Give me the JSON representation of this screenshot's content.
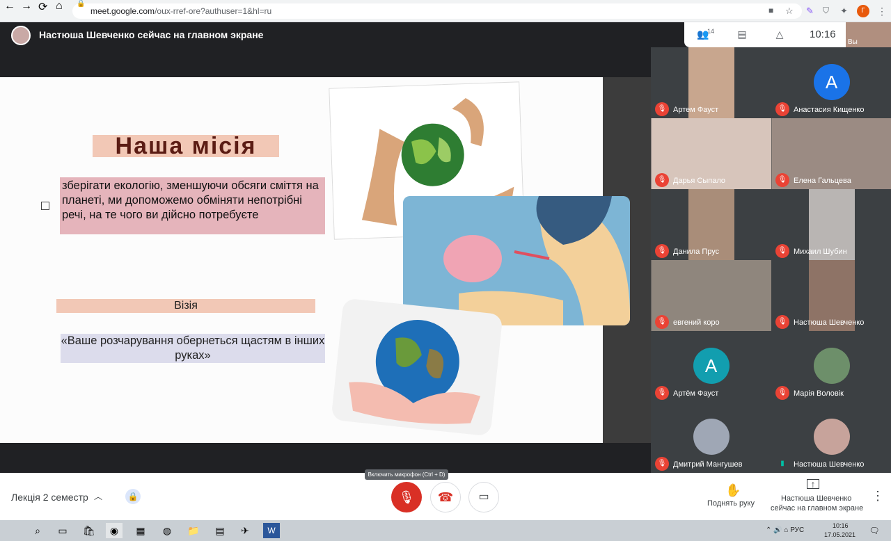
{
  "browser": {
    "url_host": "meet.google.com",
    "url_path": "/oux-rref-ore?authuser=1&hl=ru",
    "profile_letter": "Г"
  },
  "header": {
    "presenting_title": "Настюша Шевченко сейчас на главном экране",
    "participants_count": "14",
    "clock": "10:16",
    "self_label": "Вы"
  },
  "slide": {
    "mission_title": "Наша місія",
    "mission_text": "зберігати екологію, зменшуючи обсяги сміття на планеті, ми допоможемо обміняти непотрібні речі, на те чого ви дійсно потребуєте",
    "vision_title": "Візія",
    "vision_text": "«Ваше розчарування обернеться щастям в інших руках»"
  },
  "tiles": [
    {
      "name": "Артем Фауст",
      "kind": "photo",
      "color": "#c8a68e"
    },
    {
      "name": "Анастасия Кищенко",
      "kind": "avatar",
      "letter": "А",
      "color": "#1a73e8"
    },
    {
      "name": "Дарья Сыпало",
      "kind": "photo",
      "color": "#d7c5bb"
    },
    {
      "name": "Елена Гальцева",
      "kind": "photo",
      "color": "#9b8b83"
    },
    {
      "name": "Данила Прус",
      "kind": "photo",
      "color": "#a98d79"
    },
    {
      "name": "Михаил Шубин",
      "kind": "photo",
      "color": "#b9b5b3"
    },
    {
      "name": "евгений коро",
      "kind": "photo",
      "color": "#8f867d"
    },
    {
      "name": "Настюша Шевченко",
      "kind": "photo",
      "color": "#8e7366"
    },
    {
      "name": "Артём Фауст",
      "kind": "avatar",
      "letter": "А",
      "color": "#129eaf"
    },
    {
      "name": "Марія Воловік",
      "kind": "avatar",
      "letter": "",
      "color": "#6d8f6a"
    },
    {
      "name": "Дмитрий Мангушев",
      "kind": "avatar",
      "letter": "",
      "color": "#9fa7b5"
    },
    {
      "name": "Настюша Шевченко",
      "kind": "avatar",
      "letter": "",
      "color": "#c7a39b"
    }
  ],
  "bottom": {
    "meeting_name": "Лекція 2 семестр",
    "mic_tooltip": "Включить микрофон (Ctrl + D)",
    "raise_hand": "Поднять руку",
    "presenting_line1": "Настюша Шевченко",
    "presenting_line2": "сейчас на главном экране"
  },
  "taskbar": {
    "language": "РУС",
    "time": "10:16",
    "date": "17.05.2021"
  }
}
